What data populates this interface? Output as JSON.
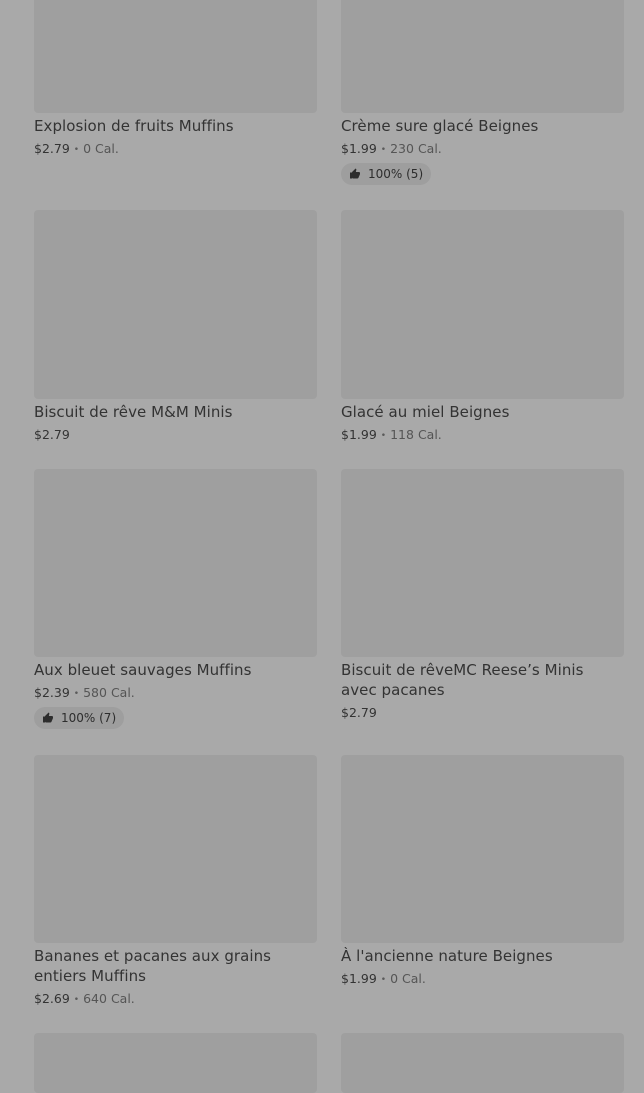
{
  "products": [
    {
      "title": "Explosion de fruits Muffins",
      "price": "$2.79",
      "calories": "0 Cal.",
      "rating": ""
    },
    {
      "title": "Crème sure glacé Beignes",
      "price": "$1.99",
      "calories": "230 Cal.",
      "rating": "100% (5)"
    },
    {
      "title": "Biscuit de rêve M&M Minis",
      "price": "$2.79",
      "calories": "",
      "rating": ""
    },
    {
      "title": "Glacé au miel Beignes",
      "price": "$1.99",
      "calories": "118 Cal.",
      "rating": ""
    },
    {
      "title": "Aux bleuet sauvages Muffins",
      "price": "$2.39",
      "calories": "580 Cal.",
      "rating": "100% (7)"
    },
    {
      "title": "Biscuit de rêveMC Reese’s Minis avec pacanes",
      "price": "$2.79",
      "calories": "",
      "rating": ""
    },
    {
      "title": "Bananes et pacanes aux grains entiers Muffins",
      "price": "$2.69",
      "calories": "640 Cal.",
      "rating": ""
    },
    {
      "title": "À l'ancienne nature Beignes",
      "price": "$1.99",
      "calories": "0 Cal.",
      "rating": ""
    }
  ],
  "separator": "•",
  "icons": {
    "rating": "thumbs-up-icon"
  }
}
